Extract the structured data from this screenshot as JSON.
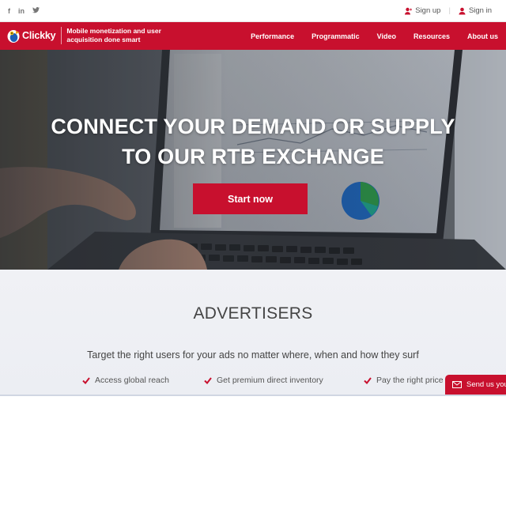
{
  "topbar": {
    "social": [
      {
        "icon": "facebook-icon",
        "glyph": "f"
      },
      {
        "icon": "linkedin-icon",
        "glyph": "in"
      },
      {
        "icon": "twitter-icon",
        "glyph": "t"
      }
    ],
    "signup_label": "Sign up",
    "signin_label": "Sign in"
  },
  "header": {
    "logo_text": "Clickky",
    "tagline": "Mobile monetization and user acquisition done smart",
    "nav": [
      "Performance",
      "Programmatic",
      "Video",
      "Resources",
      "About us"
    ]
  },
  "hero": {
    "title_line1": "CONNECT YOUR DEMAND OR SUPPLY",
    "title_line2": "TO OUR RTB EXCHANGE",
    "cta_label": "Start now"
  },
  "advertisers": {
    "title": "ADVERTISERS",
    "subtitle": "Target the right users for your ads no matter where, when and how they surf",
    "features": [
      "Access global reach",
      "Get premium direct inventory",
      "Pay the right price"
    ]
  },
  "contact_tab": {
    "label": "Send us your"
  },
  "colors": {
    "brand_red": "#c8102e",
    "text_dark": "#444444",
    "section_bg": "#eef0f5"
  }
}
